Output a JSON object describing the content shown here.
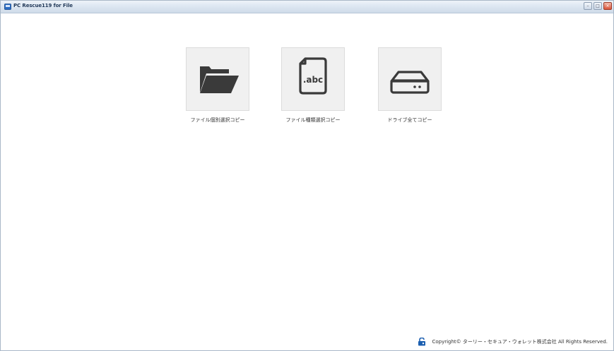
{
  "window": {
    "title": "PC Rescue119 for File",
    "controls": {
      "minimize_icon": "minimize-icon",
      "maximize_icon": "maximize-icon",
      "close_icon": "close-icon"
    }
  },
  "tiles": [
    {
      "label": "ファイル個別選択コピー",
      "icon": "folder-open-icon"
    },
    {
      "label": "ファイル種類選択コピー",
      "icon": "file-type-icon",
      "icon_text": ".abc"
    },
    {
      "label": "ドライブ全てコピー",
      "icon": "drive-icon"
    }
  ],
  "footer": {
    "logo_icon": "company-logo-icon",
    "copyright": "Copyright© ターリー・セキュア・ウォレット株式会社 All Rights Reserved."
  },
  "colors": {
    "tile_bg": "#f0f0f0",
    "icon_dark": "#3a3a3a",
    "logo_blue": "#1c5fb0"
  }
}
